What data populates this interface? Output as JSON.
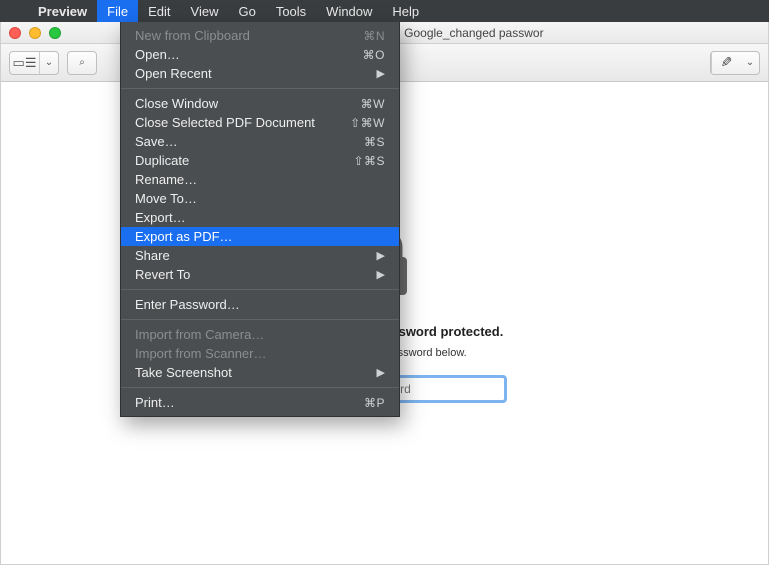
{
  "menubar": {
    "app": "Preview",
    "items": [
      "File",
      "Edit",
      "View",
      "Go",
      "Tools",
      "Window",
      "Help"
    ],
    "open_index": 0
  },
  "window": {
    "title": "protect you- Security advice from Google_changed passwor"
  },
  "toolbar": {
    "sidebar_glyph": "▭☰",
    "sidebar_chevron": "⌄",
    "zoom_minus": "−",
    "zoom_plus": "+",
    "markup_glyph": "✎",
    "markup_chevron": "⌄",
    "zoom_icon": "⌕"
  },
  "file_menu": [
    {
      "label": "New from Clipboard",
      "shortcut": "⌘N",
      "disabled": true
    },
    {
      "label": "Open…",
      "shortcut": "⌘O"
    },
    {
      "label": "Open Recent",
      "submenu": true
    },
    {
      "sep": true
    },
    {
      "label": "Close Window",
      "shortcut": "⌘W"
    },
    {
      "label": "Close Selected PDF Document",
      "shortcut": "⇧⌘W"
    },
    {
      "label": "Save…",
      "shortcut": "⌘S"
    },
    {
      "label": "Duplicate",
      "shortcut": "⇧⌘S"
    },
    {
      "label": "Rename…"
    },
    {
      "label": "Move To…"
    },
    {
      "label": "Export…"
    },
    {
      "label": "Export as PDF…",
      "highlight": true
    },
    {
      "label": "Share",
      "submenu": true
    },
    {
      "label": "Revert To",
      "submenu": true
    },
    {
      "sep": true
    },
    {
      "label": "Enter Password…"
    },
    {
      "sep": true
    },
    {
      "label": "Import from Camera…",
      "disabled": true
    },
    {
      "label": "Import from Scanner…",
      "disabled": true
    },
    {
      "label": "Take Screenshot",
      "submenu": true
    },
    {
      "sep": true
    },
    {
      "label": "Print…",
      "shortcut": "⌘P"
    }
  ],
  "lock": {
    "heading": "This document is password protected.",
    "sub": "Please enter the password below.",
    "placeholder": "Password"
  }
}
